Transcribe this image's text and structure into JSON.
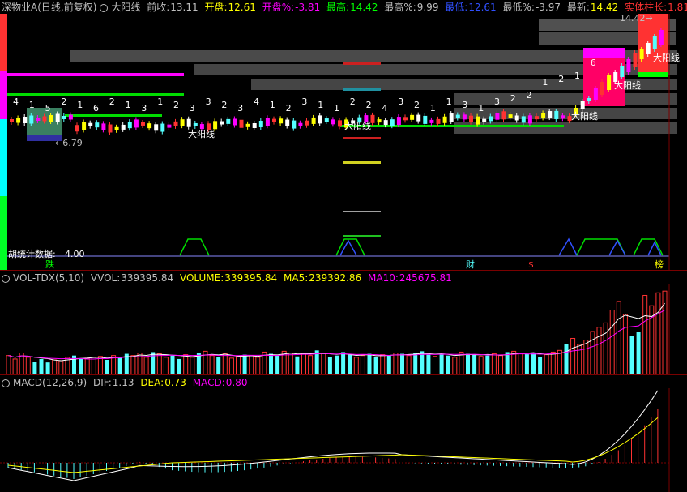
{
  "header": {
    "stock_name": "深物业A(日线,前复权)",
    "indicator": "大阳线",
    "prev_close_label": "前收:",
    "prev_close": "13.11",
    "open_label": "开盘:",
    "open": "12.61",
    "open_pct_label": "开盘%:",
    "open_pct": "-3.81",
    "high_label": "最高:",
    "high": "14.42",
    "high_pct_label": "最高%:",
    "high_pct": "9.99",
    "low_label": "最低:",
    "low": "12.61",
    "low_pct_label": "最低%:",
    "low_pct": "-3.97",
    "last_label": "最新:",
    "last": "14.42",
    "body_len_label": "实体柱长:",
    "body_len": "1.81"
  },
  "main_chart": {
    "price_low_marker": "6.79",
    "price_high_marker": "14.42",
    "pattern_label": "大阳线",
    "stats_label": "胡统计数据:",
    "stats_value": "4.00",
    "markers": [
      "跌",
      "财",
      "$",
      "榜"
    ],
    "digit_labels": [
      "4",
      "1",
      "5",
      "2",
      "1",
      "6",
      "2",
      "1",
      "3",
      "1",
      "2",
      "3",
      "3",
      "2",
      "3",
      "4",
      "1",
      "2",
      "3",
      "1",
      "1",
      "2",
      "2",
      "4",
      "3",
      "2",
      "1",
      "1",
      "3",
      "1",
      "3",
      "2",
      "2",
      "1",
      "2",
      "1",
      "6"
    ]
  },
  "volume_panel": {
    "title": "VOL-TDX(5,10)",
    "vvol_label": "VVOL:",
    "vvol": "339395.84",
    "volume_label": "VOLUME:",
    "volume": "339395.84",
    "ma5_label": "MA5:",
    "ma5": "239392.86",
    "ma10_label": "MA10:",
    "ma10": "245675.81"
  },
  "macd_panel": {
    "title": "MACD(12,26,9)",
    "dif_label": "DIF:",
    "dif": "1.13",
    "dea_label": "DEA:",
    "dea": "0.73",
    "macd_label": "MACD:",
    "macd": "0.80"
  },
  "colors": {
    "up": "#ff3232",
    "down": "#54ffff",
    "yellow": "#ffff00",
    "magenta": "#ff00ff",
    "green": "#00ff00",
    "white": "#ffffff",
    "grey_band": "#505050",
    "red_text": "#ff3232"
  },
  "volume_data": {
    "bars": [
      0.22,
      0.18,
      0.25,
      0.2,
      0.15,
      0.18,
      0.14,
      0.17,
      0.16,
      0.2,
      0.22,
      0.18,
      0.19,
      0.2,
      0.21,
      0.17,
      0.22,
      0.2,
      0.24,
      0.22,
      0.25,
      0.2,
      0.26,
      0.24,
      0.2,
      0.22,
      0.18,
      0.23,
      0.2,
      0.25,
      0.27,
      0.22,
      0.2,
      0.24,
      0.19,
      0.21,
      0.23,
      0.22,
      0.2,
      0.26,
      0.24,
      0.22,
      0.27,
      0.25,
      0.21,
      0.25,
      0.22,
      0.28,
      0.25,
      0.2,
      0.22,
      0.26,
      0.23,
      0.2,
      0.22,
      0.24,
      0.2,
      0.23,
      0.22,
      0.25,
      0.24,
      0.22,
      0.25,
      0.27,
      0.23,
      0.21,
      0.24,
      0.22,
      0.2,
      0.26,
      0.24,
      0.23,
      0.21,
      0.22,
      0.24,
      0.22,
      0.26,
      0.27,
      0.25,
      0.24,
      0.25,
      0.2,
      0.23,
      0.26,
      0.28,
      0.35,
      0.42,
      0.35,
      0.4,
      0.5,
      0.55,
      0.6,
      0.75,
      0.85,
      0.7,
      0.45,
      0.5,
      0.92,
      0.8,
      0.95,
      0.97
    ],
    "up": [
      true,
      true,
      true,
      true,
      false,
      false,
      false,
      true,
      true,
      true,
      false,
      false,
      true,
      true,
      true,
      false,
      true,
      false,
      false,
      true,
      true,
      true,
      false,
      true,
      true,
      false,
      false,
      true,
      true,
      false,
      true,
      true,
      false,
      true,
      true,
      true,
      false,
      true,
      true,
      true,
      false,
      false,
      true,
      true,
      false,
      true,
      true,
      false,
      true,
      false,
      false,
      false,
      false,
      true,
      true,
      false,
      false,
      true,
      false,
      true,
      false,
      true,
      false,
      false,
      false,
      true,
      false,
      false,
      true,
      true,
      false,
      false,
      true,
      false,
      true,
      true,
      false,
      true,
      true,
      false,
      false,
      false,
      true,
      true,
      true,
      false,
      true,
      true,
      true,
      true,
      true,
      true,
      true,
      true,
      true,
      false,
      false,
      true,
      true,
      true,
      true
    ]
  }
}
